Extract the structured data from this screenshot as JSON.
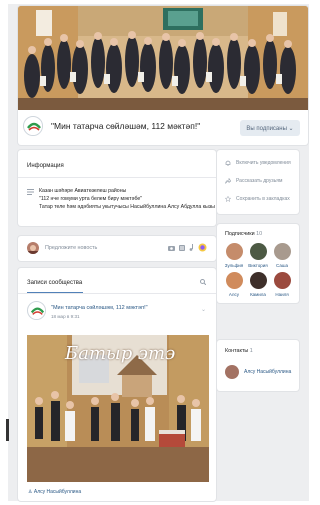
{
  "group": {
    "name": "\"Мин татарча сөйләшәм, 112 мәктәп!\"",
    "subscribe_button": "Вы подписаны ⌄"
  },
  "info": {
    "title": "Информация",
    "lines": [
      "Казан шәһәре Авиатөзелеш районы",
      "\"112 нче гомуми урта белем бирү мәктәбе\"",
      "Татар теле һәм әдәбияты укытучысы Насыйбуллина Алсу Абдулла кызы"
    ],
    "icon": "list-icon"
  },
  "suggest": {
    "placeholder": "Предложите новость",
    "icons": [
      "camera-icon",
      "video-icon",
      "music-icon",
      "more-icon"
    ]
  },
  "wall": {
    "title": "Записи сообщества",
    "post": {
      "author": "\"Мин татарча сөйләшәм, 112 мәктәп!\"",
      "date": "18 мар в 9:31",
      "photo_caption": "Батыр этэ",
      "signer": "♙ Алсу Насыйбуллина"
    }
  },
  "actions": [
    {
      "label": "Включить уведомления",
      "icon": "bell-icon"
    },
    {
      "label": "Рассказать друзьям",
      "icon": "share-icon"
    },
    {
      "label": "Сохранить в закладках",
      "icon": "star-icon"
    }
  ],
  "subscribers": {
    "title": "Подписчики",
    "count": "10",
    "members": [
      "Зульфия",
      "Виктория",
      "Саша",
      "Алсу",
      "Камила",
      "Наиля"
    ]
  },
  "contacts": {
    "title": "Контакты",
    "count": "1",
    "name": "Алсу Насыйбуллина"
  },
  "colors": {
    "background": "#edeef0",
    "link": "#2a5885",
    "muted": "#818c99",
    "accent": "#5181b8",
    "button": "#e5ebf1"
  }
}
